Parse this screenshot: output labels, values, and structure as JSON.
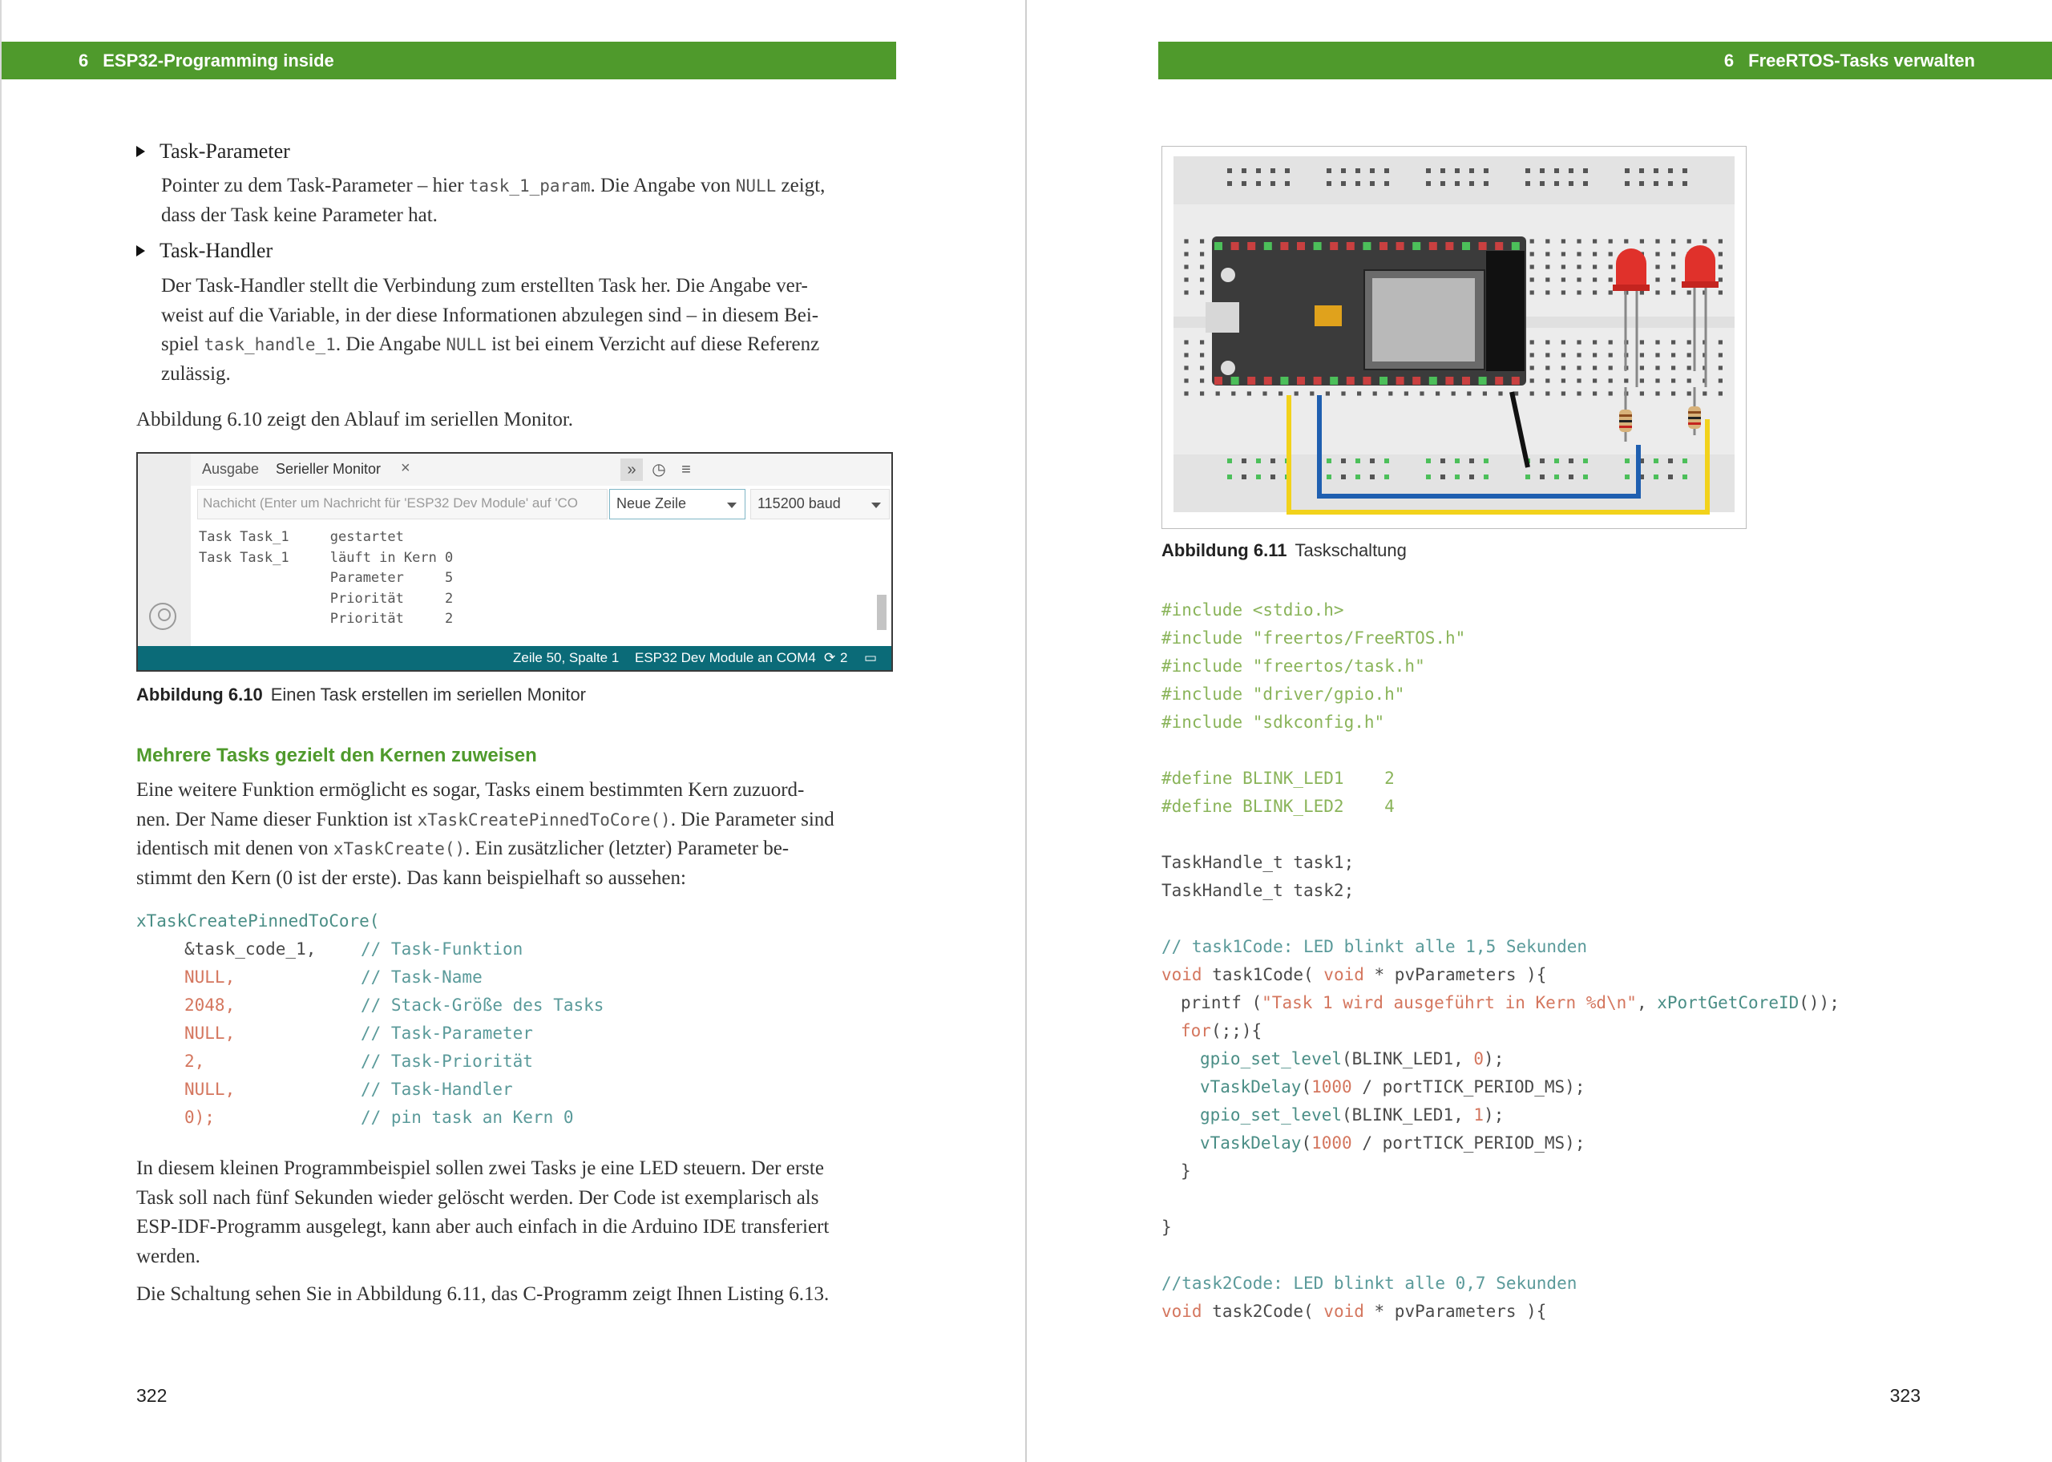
{
  "left_page": {
    "header": {
      "chapter_number": "6",
      "chapter_title": "ESP32-Programming inside"
    },
    "bullets": [
      {
        "title": "Task-Parameter",
        "text_before": "Pointer zu dem Task-Parameter – hier ",
        "code1": "task_1_param",
        "text_mid": ". Die Angabe von ",
        "code2": "NULL",
        "text_after1": " zeigt,",
        "line2": "dass der Task keine Parameter hat."
      },
      {
        "title": "Task-Handler",
        "line1": "Der Task-Handler stellt die Verbindung zum erstellten Task her. Die Angabe ver-",
        "line2": "weist auf die Variable, in der diese Informationen abzulegen sind – in diesem Bei-",
        "line3_a": "spiel ",
        "line3_code1": "task_handle_1",
        "line3_b": ". Die Angabe ",
        "line3_code2": "NULL",
        "line3_c": " ist bei einem Verzicht auf diese Referenz",
        "line4": "zulässig."
      }
    ],
    "para_fig610_intro": "Abbildung 6.10 zeigt den Ablauf im seriellen Monitor.",
    "serial_monitor": {
      "tab_output": "Ausgabe",
      "tab_serial": "Serieller Monitor",
      "tab_close": "×",
      "icons": [
        "collapse-icon",
        "clock-icon",
        "menu-icon"
      ],
      "input_placeholder": "Nachicht (Enter um Nachricht für 'ESP32 Dev Module' auf 'CO",
      "line_ending": "Neue Zeile",
      "baud": "115200 baud",
      "output_lines": [
        "Task Task_1     gestartet",
        "Task Task_1     läuft in Kern 0",
        "                Parameter     5",
        "                Priorität     2",
        "                Priorität     2"
      ],
      "status_position": "Zeile 50, Spalte 1",
      "status_board": "ESP32 Dev Module an COM4",
      "status_count": "2"
    },
    "caption_610": {
      "label": "Abbildung 6.10",
      "text": "Einen Task erstellen im seriellen Monitor"
    },
    "subheading": "Mehrere Tasks gezielt den Kernen zuweisen",
    "para2": {
      "l1": "Eine weitere Funktion ermöglicht es sogar, Tasks einem bestimmten Kern zuzuord-",
      "l2_a": "nen. Der Name dieser Funktion ist ",
      "l2_code": "xTaskCreatePinnedToCore()",
      "l2_b": ". Die Parameter sind",
      "l3_a": "identisch mit denen von ",
      "l3_code": "xTaskCreate()",
      "l3_b": ". Ein zusätzlicher (letzter) Parameter be-",
      "l4": "stimmt den Kern (0 ist der erste). Das kann beispielhaft so aussehen:"
    },
    "code_block": {
      "fn": "xTaskCreatePinnedToCore(",
      "args": [
        {
          "arg": "&task_code_1,",
          "comment": "// Task-Funktion"
        },
        {
          "arg": "NULL,",
          "comment": "// Task-Name"
        },
        {
          "arg": "2048,",
          "comment": "// Stack-Größe des Tasks"
        },
        {
          "arg": "NULL,",
          "comment": "// Task-Parameter"
        },
        {
          "arg": "2,",
          "comment": "// Task-Priorität"
        },
        {
          "arg": "NULL,",
          "comment": "// Task-Handler"
        },
        {
          "arg": "0);",
          "comment": "// pin task an Kern 0"
        }
      ]
    },
    "para3": [
      "In diesem kleinen Programmbeispiel sollen zwei Tasks je eine LED steuern. Der erste",
      "Task soll nach fünf Sekunden wieder gelöscht werden. Der Code ist exemplarisch als",
      "ESP-IDF-Programm ausgelegt, kann aber auch einfach in die Arduino IDE transferiert",
      "werden."
    ],
    "para4": "Die Schaltung sehen Sie in Abbildung 6.11, das C-Programm zeigt Ihnen Listing 6.13.",
    "page_number": "322"
  },
  "right_page": {
    "header": {
      "chapter_number": "6",
      "chapter_title": "FreeRTOS-Tasks verwalten"
    },
    "caption_611": {
      "label": "Abbildung 6.11",
      "text": "Taskschaltung"
    },
    "figure_colors": {
      "led": "#e0312b",
      "wire_yellow": "#f2d21b",
      "wire_blue": "#1f5fb0",
      "board": "#3b3b3b",
      "breadboard": "#ededed"
    },
    "code_lines": {
      "inc1": "#include <stdio.h>",
      "inc2": "#include \"freertos/FreeRTOS.h\"",
      "inc3": "#include \"freertos/task.h\"",
      "inc4": "#include \"driver/gpio.h\"",
      "inc5": "#include \"sdkconfig.h\"",
      "def1": "#define BLINK_LED1    2",
      "def2": "#define BLINK_LED2    4",
      "th1": "TaskHandle_t task1;",
      "th2": "TaskHandle_t task2;",
      "com1": "// task1Code: LED blinkt alle 1,5 Sekunden",
      "fn1_kw": "void",
      "fn1_name": " task1Code( ",
      "fn1_kw2": "void",
      "fn1_rest": " * pvParameters ){",
      "printf_a": "printf (",
      "printf_str": "\"Task 1 wird ausgeführt in Kern %d\\n\"",
      "printf_b": ", ",
      "printf_fn": "xPortGetCoreID",
      "printf_c": "());",
      "for_kw": "for",
      "for_rest": "(;;){",
      "g1_fn": "gpio_set_level",
      "g1_a": "(BLINK_LED1, ",
      "g1_num": "0",
      "g1_b": ");",
      "d1_fn": "vTaskDelay",
      "d1_a": "(",
      "d1_num": "1000",
      "d1_b": " / portTICK_PERIOD_MS);",
      "g2_fn": "gpio_set_level",
      "g2_a": "(BLINK_LED1, ",
      "g2_num": "1",
      "g2_b": ");",
      "d2_fn": "vTaskDelay",
      "d2_a": "(",
      "d2_num": "1000",
      "d2_b": " / portTICK_PERIOD_MS);",
      "close_inner": "}",
      "close_outer": "}",
      "com2": "//task2Code: LED blinkt alle 0,7 Sekunden",
      "fn2_kw": "void",
      "fn2_name": " task2Code( ",
      "fn2_kw2": "void",
      "fn2_rest": " * pvParameters ){"
    },
    "page_number": "323"
  }
}
